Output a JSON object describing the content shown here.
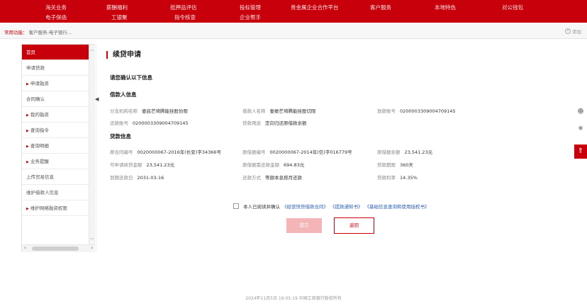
{
  "topnav": {
    "row1": [
      "海关业务",
      "薪酬福利",
      "抵押品评估",
      "投标管理",
      "贵金属企业合作平台",
      "客户服务",
      "本地特色",
      "对公钱包"
    ],
    "row2": [
      "电子保函",
      "工银聚",
      "指令核查",
      "企业帮手"
    ]
  },
  "subbar": {
    "quick_label": "常用功能：",
    "quick_path": "客户服务-电子银行...",
    "add_label": "添加",
    "add_icon": "+"
  },
  "sidebar": {
    "items": [
      {
        "label": "首页",
        "arrow": false,
        "active": true
      },
      {
        "label": "申请贷款",
        "arrow": false,
        "active": false
      },
      {
        "label": "申请融资",
        "arrow": true,
        "active": false
      },
      {
        "label": "合同确认",
        "arrow": false,
        "active": false
      },
      {
        "label": "我的融资",
        "arrow": true,
        "active": false
      },
      {
        "label": "查询指令",
        "arrow": true,
        "active": false
      },
      {
        "label": "查询明细",
        "arrow": true,
        "active": false
      },
      {
        "label": "业务提醒",
        "arrow": true,
        "active": false
      },
      {
        "label": "上传贸易信息",
        "arrow": false,
        "active": false
      },
      {
        "label": "维护借款人信息",
        "arrow": false,
        "active": false
      },
      {
        "label": "维护网络融资权限",
        "arrow": true,
        "active": false
      }
    ]
  },
  "page": {
    "title": "续贷申请",
    "confirm_heading": "请您确认以下信息",
    "borrower_heading": "借款人信息",
    "loan_heading": "贷款信息"
  },
  "borrower": [
    {
      "key": "分支机构名称",
      "value": "娄底芒埼腾能拴股份限"
    },
    {
      "key": "借款人名称",
      "value": "娄敢芒埼腾能拴股切限"
    },
    {
      "key": "放款账号",
      "value": "0200003309004709145"
    },
    {
      "key": "还款账号",
      "value": "0200003309004709145"
    },
    {
      "key": "贷款用途",
      "value": "定向归还原借款余额"
    }
  ],
  "loan": [
    {
      "key": "原合同编号",
      "value": "0020000067-2016年(长安)字34366号"
    },
    {
      "key": "原借据编号",
      "value": "0020000067-2014年(信)字016779号"
    },
    {
      "key": "原借据余额",
      "value": "23,541.23元"
    },
    {
      "key": "可申请续贷金额",
      "value": "23,541.23元"
    },
    {
      "key": "原借据需还款金额",
      "value": "694.83元"
    },
    {
      "key": "贷款期限",
      "value": "360天"
    },
    {
      "key": "到期还款日",
      "value": "2031-03-16"
    },
    {
      "key": "还款方式",
      "value": "等额本息按月还款"
    },
    {
      "key": "贷款利率",
      "value": "14.35%"
    }
  ],
  "agreement": {
    "text": "本人已阅读并确认",
    "links": [
      "《经营快贷借款合同》",
      "《提款通知书》",
      "《基础信息查询和使用授权书》"
    ],
    "checked": false
  },
  "buttons": {
    "submit": "提交",
    "back": "返回"
  },
  "footer": "2024年11月5日 16:05:19   中国工商银行版权所有",
  "colors": {
    "brand_red": "#c7000b",
    "link_blue": "#2b5fb7"
  }
}
